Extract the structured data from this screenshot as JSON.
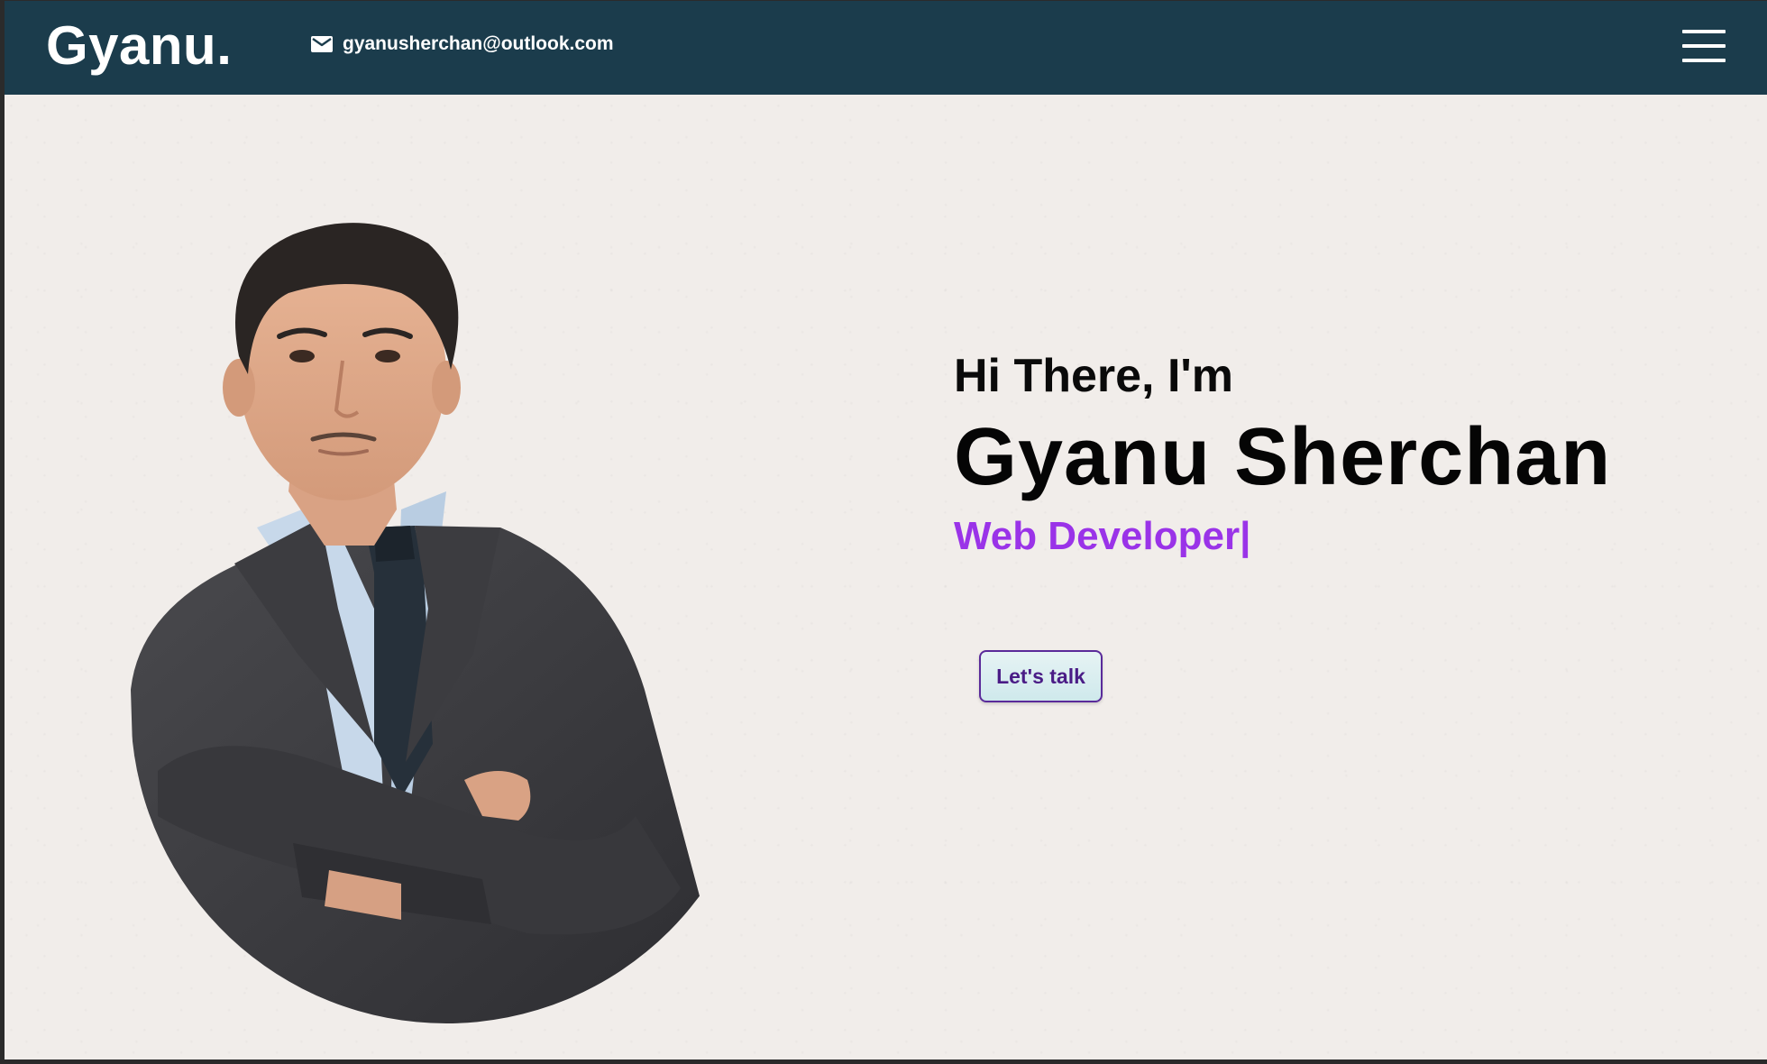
{
  "navbar": {
    "logo": "Gyanu.",
    "email": "gyanusherchan@outlook.com",
    "icons": {
      "mail": "mail-icon",
      "menu": "hamburger-menu-icon"
    }
  },
  "hero": {
    "greeting": "Hi There, I'm",
    "name": "Gyanu Sherchan",
    "role": "Web Developer|",
    "cta_label": "Let's talk",
    "portrait": "profile-photo"
  },
  "colors": {
    "navbar": "#1b3c4c",
    "background": "#f1edea",
    "role_accent": "#9a33e8",
    "cta_text": "#4a1c86",
    "cta_border": "#5a2a9a"
  }
}
